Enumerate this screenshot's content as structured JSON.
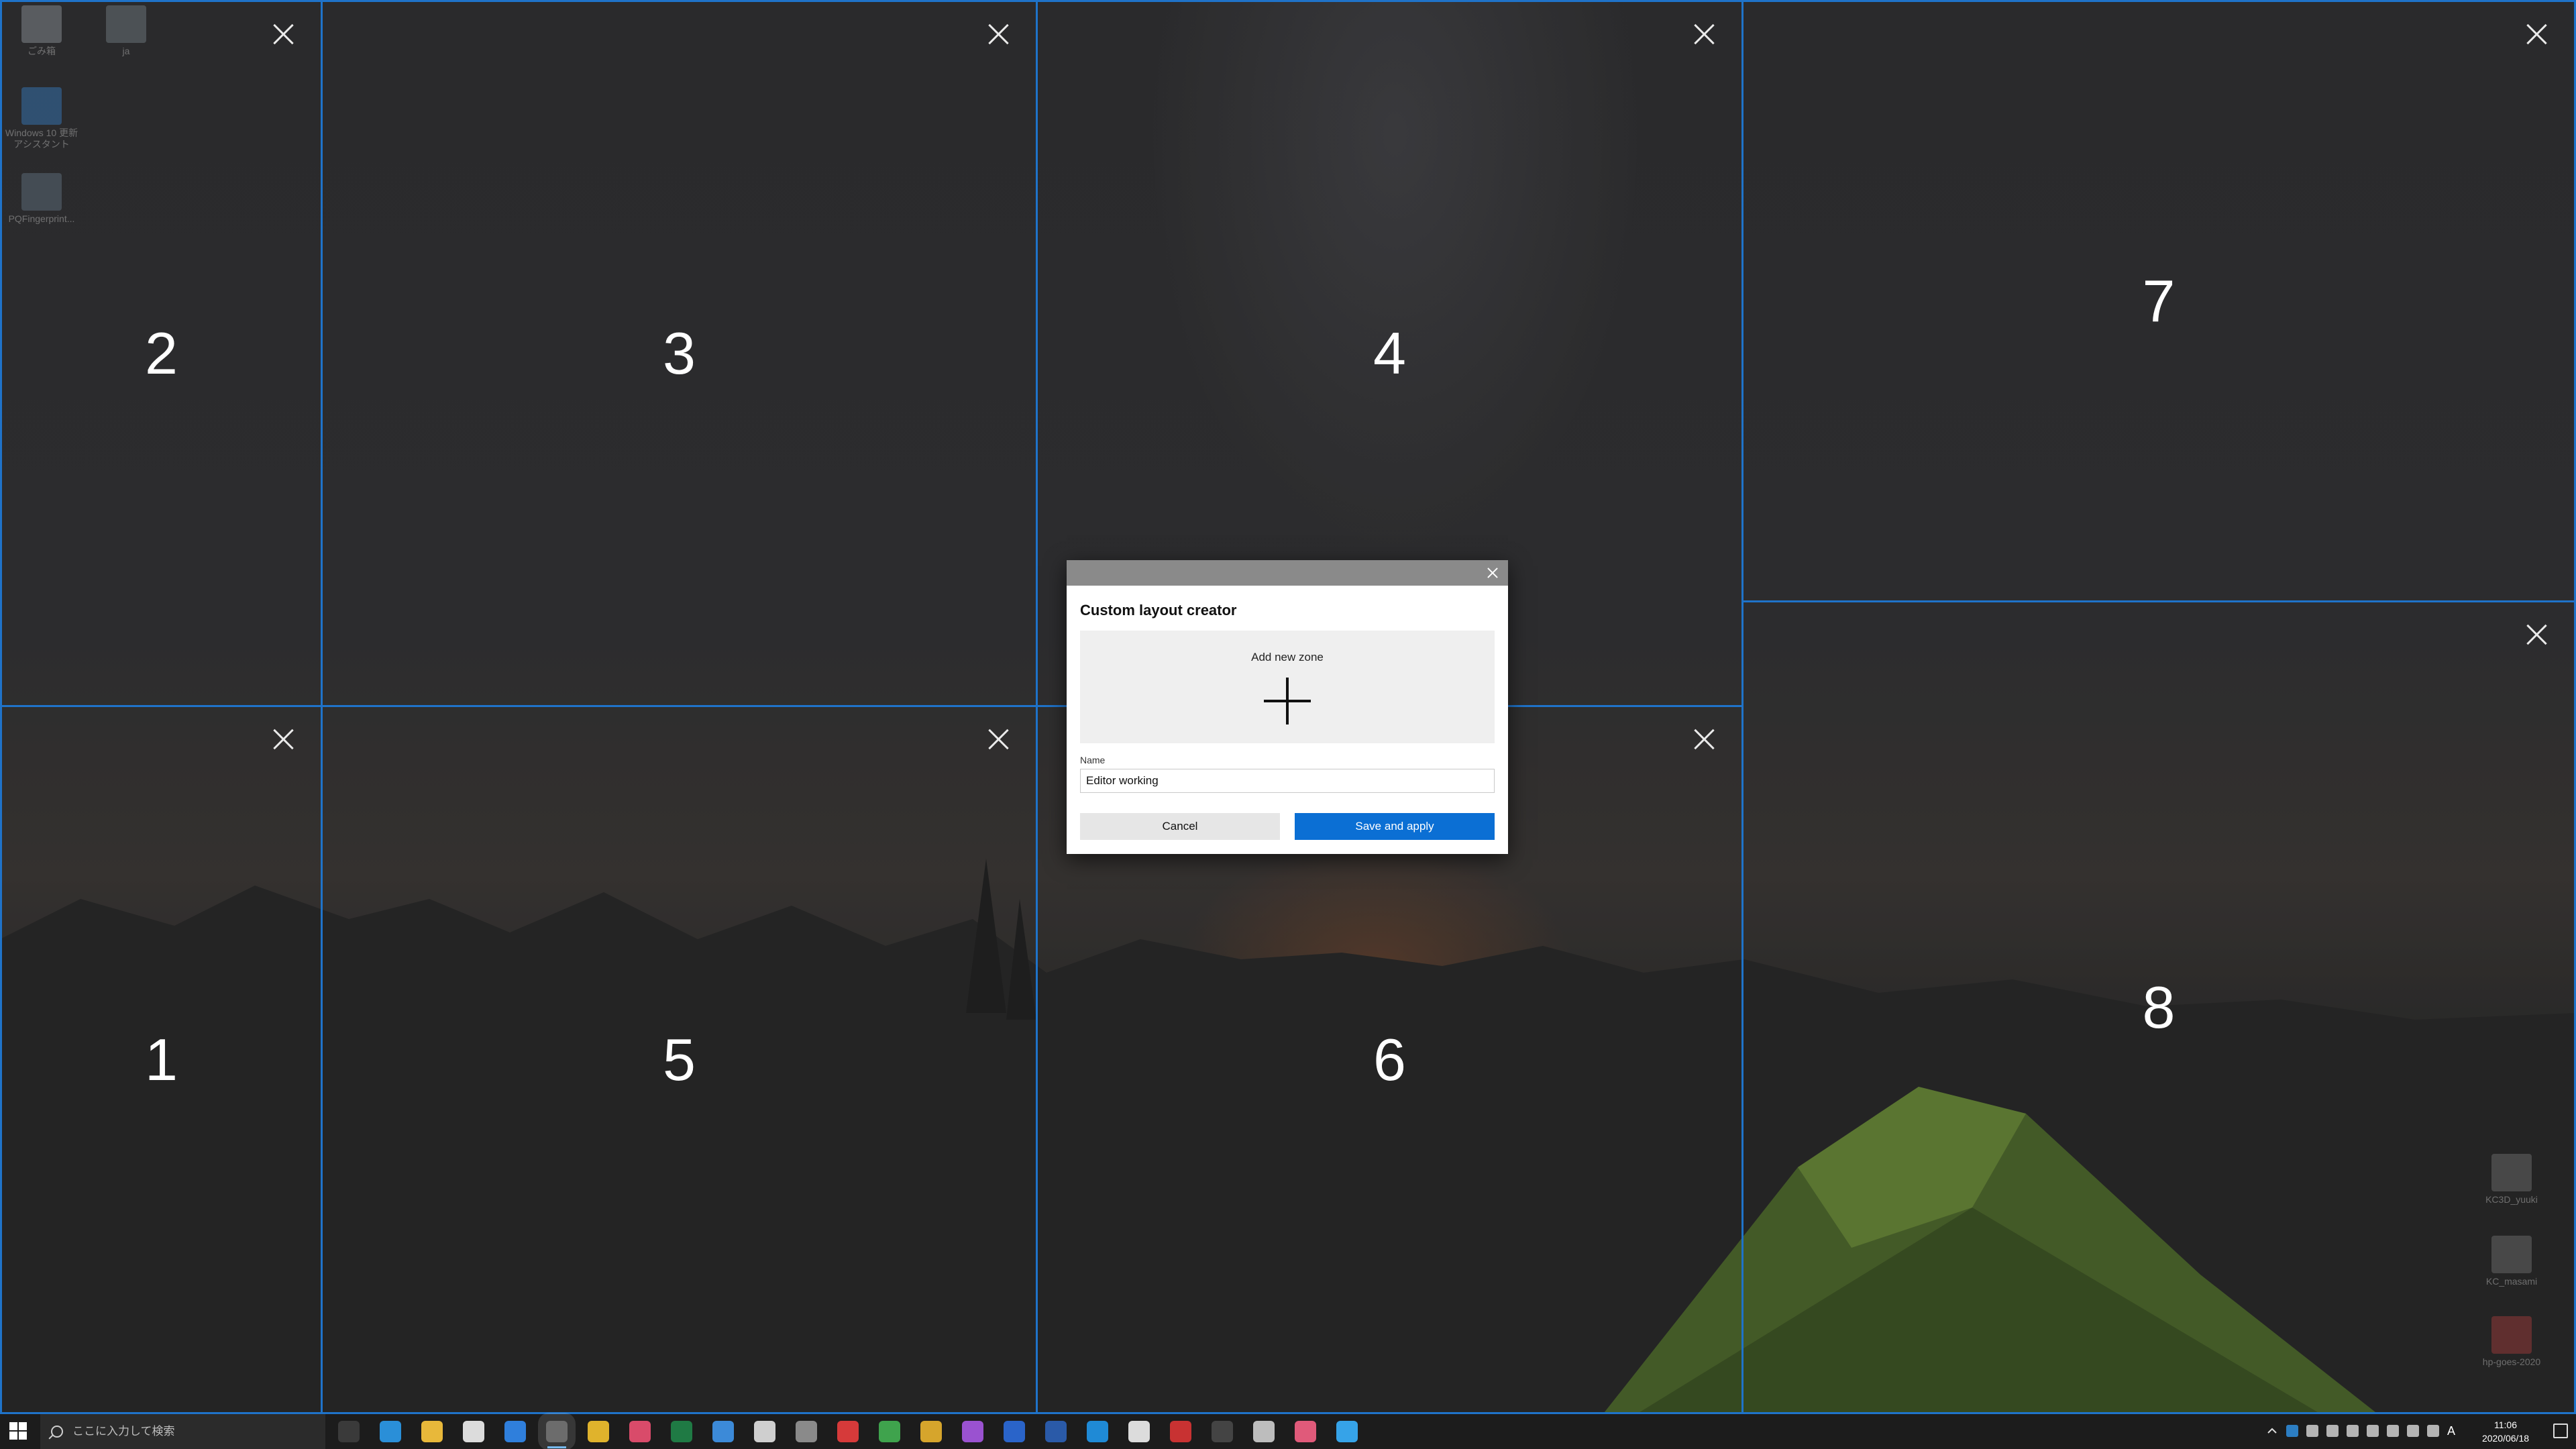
{
  "desktop": {
    "icons_left": [
      {
        "label": "ごみ箱",
        "color": "#9aa1a8"
      },
      {
        "label": "ja",
        "color": "#7d8891"
      },
      {
        "label": "Windows 10 更新アシスタント",
        "color": "#3a86d0"
      },
      {
        "label": "PQFingerprint...",
        "color": "#6a7d8c"
      }
    ],
    "icons_right": [
      {
        "label": "KC3D_yuuki",
        "color": "#7a7a7a"
      },
      {
        "label": "KC_masami",
        "color": "#7a7a7a"
      },
      {
        "label": "hp-goes-2020",
        "color": "#b04040"
      }
    ]
  },
  "zones": [
    {
      "id": "2",
      "number": "2"
    },
    {
      "id": "3",
      "number": "3"
    },
    {
      "id": "4",
      "number": "4"
    },
    {
      "id": "7",
      "number": "7"
    },
    {
      "id": "1",
      "number": "1"
    },
    {
      "id": "5",
      "number": "5"
    },
    {
      "id": "6",
      "number": "6"
    },
    {
      "id": "8",
      "number": "8"
    }
  ],
  "dialog": {
    "title": "Custom layout creator",
    "add_zone_label": "Add new zone",
    "name_label": "Name",
    "name_value": "Editor working",
    "cancel_label": "Cancel",
    "save_label": "Save and apply"
  },
  "taskbar": {
    "search_placeholder": "ここに入力して検索",
    "apps": [
      {
        "icon": "task-view-icon",
        "color": "#3a3a3a"
      },
      {
        "icon": "edge-icon",
        "color": "#2a8fd8"
      },
      {
        "icon": "file-explorer-icon",
        "color": "#e8b83a"
      },
      {
        "icon": "store-icon",
        "color": "#dcdcdc"
      },
      {
        "icon": "maps-icon",
        "color": "#2f7fdc"
      },
      {
        "icon": "app-active-icon",
        "color": "#6c6c6c"
      },
      {
        "icon": "chrome-icon",
        "color": "#e0b32c"
      },
      {
        "icon": "slack-icon",
        "color": "#d94b6a"
      },
      {
        "icon": "excel-icon",
        "color": "#1f7a44"
      },
      {
        "icon": "app-icon-1",
        "color": "#3c8ad8"
      },
      {
        "icon": "app-icon-2",
        "color": "#cfcfcf"
      },
      {
        "icon": "app-icon-3",
        "color": "#8a8a8a"
      },
      {
        "icon": "vivaldi-icon",
        "color": "#d63a3a"
      },
      {
        "icon": "chrome-icon-2",
        "color": "#3fa34d"
      },
      {
        "icon": "chrome-icon-3",
        "color": "#d6a52c"
      },
      {
        "icon": "github-icon",
        "color": "#9a52d0"
      },
      {
        "icon": "1password-icon",
        "color": "#2a64c9"
      },
      {
        "icon": "powershell-icon",
        "color": "#2a5aa8"
      },
      {
        "icon": "vscode-icon",
        "color": "#1f8ad6"
      },
      {
        "icon": "app-icon-4",
        "color": "#dcdcdc"
      },
      {
        "icon": "app-icon-5",
        "color": "#c83232"
      },
      {
        "icon": "terminal-icon",
        "color": "#444444"
      },
      {
        "icon": "app-icon-6",
        "color": "#bdbdbd"
      },
      {
        "icon": "app-icon-7",
        "color": "#e05a7a"
      },
      {
        "icon": "powertoys-icon",
        "color": "#36a3e8"
      }
    ],
    "clock_time": "11:06",
    "clock_date": "2020/06/18",
    "ime": "A"
  },
  "colors": {
    "zone_border": "#1f73c9",
    "accent_button": "#0b6fd4",
    "taskbar": "#1c1c1c"
  }
}
